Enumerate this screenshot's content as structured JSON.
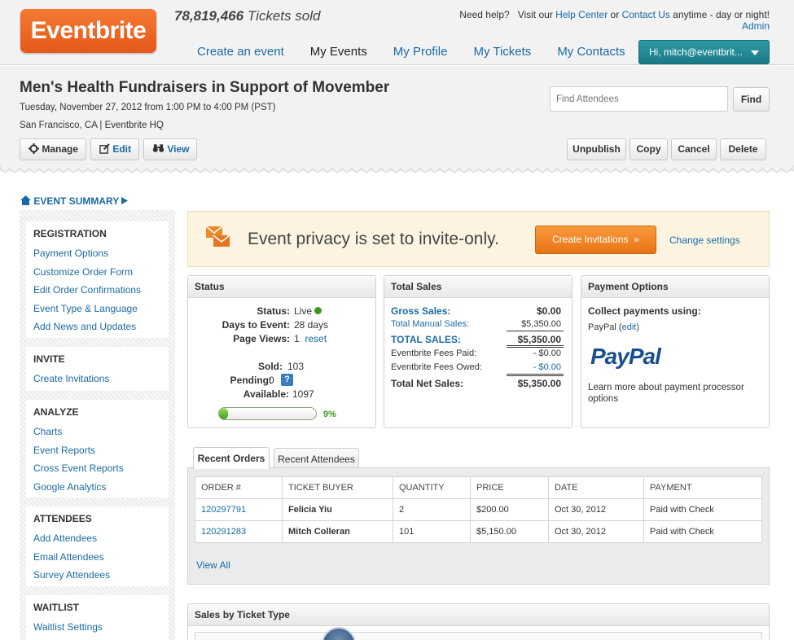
{
  "header": {
    "logo_text": "Eventbrite",
    "tickets_count": "78,819,466",
    "tickets_suffix": "Tickets sold",
    "help_prefix": "Need help?",
    "help_visit": "Visit our",
    "help_center": "Help Center",
    "help_or": "or",
    "contact_us": "Contact Us",
    "help_suffix": "anytime - day or night!",
    "admin": "Admin",
    "nav": [
      {
        "label": "Create an event"
      },
      {
        "label": "My Events"
      },
      {
        "label": "My Profile"
      },
      {
        "label": "My Tickets"
      },
      {
        "label": "My Contacts"
      }
    ],
    "user_button": "Hi, mitch@eventbrit...",
    "accent_color": "#f26522"
  },
  "event": {
    "title": "Men's Health Fundraisers in Support of Movember",
    "date": "Tuesday, November 27, 2012 from 1:00 PM to 4:00 PM (PST)",
    "location": "San Francisco, CA | Eventbrite HQ",
    "find_placeholder": "Find Attendees",
    "find_button": "Find",
    "manage": "Manage",
    "edit": "Edit",
    "view": "View",
    "unpublish": "Unpublish",
    "copy": "Copy",
    "cancel": "Cancel",
    "delete": "Delete"
  },
  "sidebar": {
    "summary_link": "EVENT SUMMARY",
    "sections": [
      {
        "title": "REGISTRATION",
        "items": [
          "Payment Options",
          "Customize Order Form",
          "Edit Order Confirmations",
          "Event Type & Language",
          "Add News and Updates"
        ]
      },
      {
        "title": "INVITE",
        "items": [
          "Create Invitations"
        ]
      },
      {
        "title": "ANALYZE",
        "items": [
          "Charts",
          "Event Reports",
          "Cross Event Reports",
          "Google Analytics"
        ]
      },
      {
        "title": "ATTENDEES",
        "items": [
          "Add Attendees",
          "Email Attendees",
          "Survey Attendees"
        ]
      },
      {
        "title": "WAITLIST",
        "items": [
          "Waitlist Settings"
        ]
      }
    ]
  },
  "privacy": {
    "message": "Event privacy is set to invite-only.",
    "create_button": "Create Invitations",
    "create_arrow": "»",
    "change_settings": "Change settings"
  },
  "status": {
    "title": "Status",
    "status_label": "Status:",
    "status_value": "Live",
    "days_label": "Days to Event:",
    "days_value": "28 days",
    "views_label": "Page Views:",
    "views_value": "1",
    "reset": "reset",
    "sold_label": "Sold:",
    "sold_value": "103",
    "pending_label": "Pending:",
    "pending_value": "0",
    "available_label": "Available:",
    "available_value": "1097",
    "progress_percent": "9%",
    "progress_fraction": 0.09
  },
  "sales": {
    "title": "Total Sales",
    "rows": [
      {
        "label": "Gross Sales:",
        "value": "$0.00"
      },
      {
        "label": "Total Manual Sales:",
        "value": "$5,350.00"
      },
      {
        "label": "TOTAL SALES:",
        "value": "$5,350.00"
      },
      {
        "label": "Eventbrite Fees Paid:",
        "value": "- $0.00"
      },
      {
        "label": "Eventbrite Fees Owed:",
        "value": "- $0.00"
      },
      {
        "label": "Total Net Sales:",
        "value": "$5,350.00"
      }
    ]
  },
  "payment": {
    "title": "Payment Options",
    "collect": "Collect payments using:",
    "method": "PayPal",
    "edit": "edit",
    "logo_text": "PayPal",
    "learn_more": "Learn more about payment processor options"
  },
  "orders": {
    "tab_orders": "Recent Orders",
    "tab_attendees": "Recent Attendees",
    "columns": [
      "ORDER #",
      "TICKET BUYER",
      "QUANTITY",
      "PRICE",
      "DATE",
      "PAYMENT"
    ],
    "rows": [
      {
        "order": "120297791",
        "buyer": "Felicia Yiu",
        "qty": "2",
        "price": "$200.00",
        "date": "Oct 30, 2012",
        "payment": "Paid with Check"
      },
      {
        "order": "120291283",
        "buyer": "Mitch Colleran",
        "qty": "101",
        "price": "$5,150.00",
        "date": "Oct 30, 2012",
        "payment": "Paid with Check"
      }
    ],
    "view_all": "View All"
  },
  "ticket_types": {
    "title": "Sales by Ticket Type"
  }
}
